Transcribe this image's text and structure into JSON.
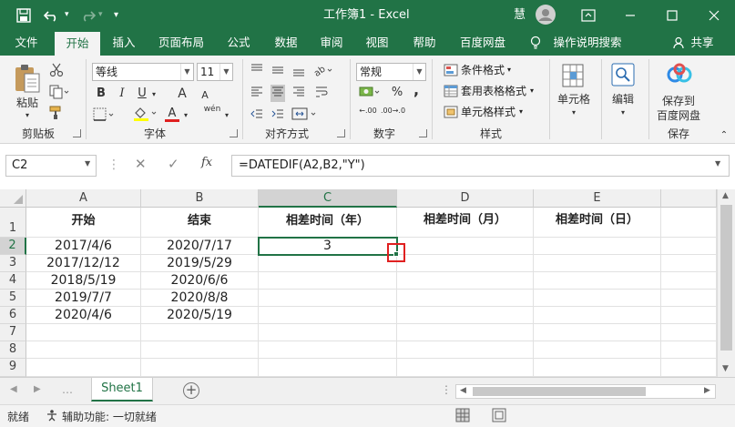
{
  "title_bar": {
    "undo_icon": "undo-icon",
    "redo_icon": "redo-icon",
    "title": "工作簿1  -  Excel",
    "user_initial": "慧",
    "ribbon_display_icon": "ribbon-display-icon"
  },
  "tabs": [
    "文件",
    "开始",
    "插入",
    "页面布局",
    "公式",
    "数据",
    "审阅",
    "视图",
    "帮助",
    "百度网盘",
    "操作说明搜索"
  ],
  "share_label": "共享",
  "ribbon": {
    "clipboard": {
      "paste": "粘贴",
      "group": "剪贴板"
    },
    "font": {
      "name": "等线",
      "size": "11",
      "group": "字体",
      "bold": "B",
      "italic": "I",
      "underline": "U",
      "grow": "A",
      "shrink": "A",
      "wen": "wén",
      "font_color_letter": "A"
    },
    "alignment": {
      "group": "对齐方式"
    },
    "number": {
      "format": "常规",
      "percent": "%",
      "comma": ",",
      "group": "数字",
      "inc_dec": "←.00",
      "dec_dec": ".00→.0"
    },
    "styles": {
      "conditional": "条件格式",
      "table": "套用表格格式",
      "cell": "单元格样式",
      "group": "样式"
    },
    "cells": {
      "label": "单元格"
    },
    "editing": {
      "label": "编辑"
    },
    "save": {
      "label1": "保存到",
      "label2": "百度网盘",
      "group": "保存"
    }
  },
  "formula_bar": {
    "name_box": "C2",
    "fx": "fx",
    "formula": "=DATEDIF(A2,B2,\"Y\")"
  },
  "columns": [
    "A",
    "B",
    "C",
    "D",
    "E"
  ],
  "rows": [
    "1",
    "2",
    "3",
    "4",
    "5",
    "6",
    "7",
    "8",
    "9"
  ],
  "headers": [
    "开始",
    "结束",
    "相差时间（年）",
    "相差时间（月）",
    "相差时间（日）"
  ],
  "data": [
    [
      "2017/4/6",
      "2020/7/17",
      "3"
    ],
    [
      "2017/12/12",
      "2019/5/29",
      ""
    ],
    [
      "2018/5/19",
      "2020/6/6",
      ""
    ],
    [
      "2019/7/7",
      "2020/8/8",
      ""
    ],
    [
      "2020/4/6",
      "2020/5/19",
      ""
    ]
  ],
  "sheet_tab": "Sheet1",
  "status": {
    "ready": "就绪",
    "accessibility": "辅助功能: 一切就绪"
  },
  "colors": {
    "excel_green": "#217346",
    "highlight_red": "#e02020"
  }
}
